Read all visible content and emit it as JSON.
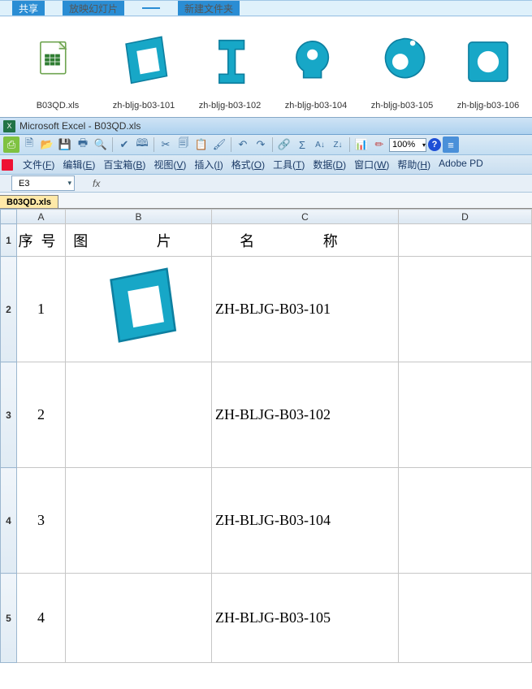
{
  "explorer": {
    "ribbon_share": "共享",
    "ribbon_slideshow": "放映幻灯片",
    "ribbon_newfolder": "新建文件夹",
    "files": [
      {
        "caption": "B03QD.xls",
        "icon": "xls"
      },
      {
        "caption": "zh-bljg-b03-101",
        "icon": "part-plate"
      },
      {
        "caption": "zh-bljg-b03-102",
        "icon": "part-uchan"
      },
      {
        "caption": "zh-bljg-b03-104",
        "icon": "part-hook"
      },
      {
        "caption": "zh-bljg-b03-105",
        "icon": "part-teard"
      },
      {
        "caption": "zh-bljg-b03-106",
        "icon": "part-ring"
      }
    ]
  },
  "excel": {
    "titlebar": "Microsoft Excel - B03QD.xls",
    "menus": [
      "文件(F)",
      "编辑(E)",
      "百宝箱(B)",
      "视图(V)",
      "插入(I)",
      "格式(O)",
      "工具(T)",
      "数据(D)",
      "窗口(W)",
      "帮助(H)",
      "Adobe PD"
    ],
    "zoom": "100%",
    "name_box": "E3",
    "fx": "fx",
    "sheet_tab": "B03QD.xls",
    "columns": [
      "",
      "A",
      "B",
      "C",
      "D"
    ],
    "header_row": {
      "a": "序号",
      "b": "图      片",
      "c": "名      称"
    },
    "rows": [
      {
        "num": "1",
        "name": "ZH-BLJG-B03-101",
        "icon": "part-plate"
      },
      {
        "num": "2",
        "name": "ZH-BLJG-B03-102",
        "icon": ""
      },
      {
        "num": "3",
        "name": "ZH-BLJG-B03-104",
        "icon": ""
      },
      {
        "num": "4",
        "name": "ZH-BLJG-B03-105",
        "icon": ""
      }
    ]
  }
}
